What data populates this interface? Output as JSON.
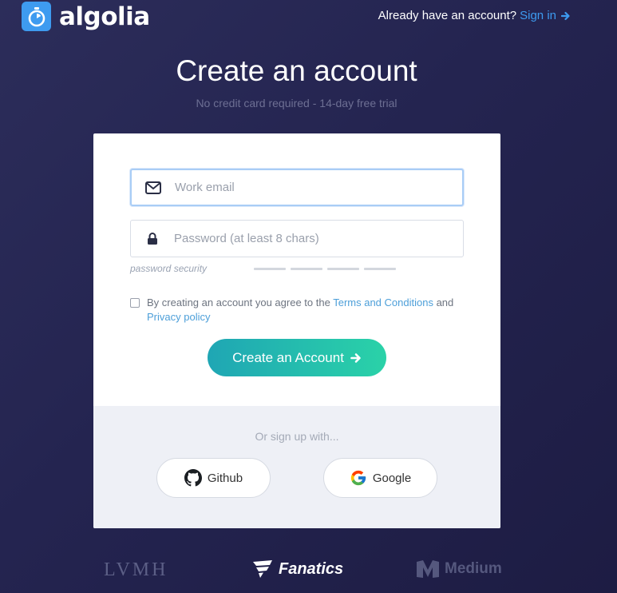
{
  "header": {
    "logo_text": "algolia",
    "signin_prompt": "Already have an account?",
    "signin_link": "Sign in"
  },
  "main": {
    "title": "Create an account",
    "subtitle": "No credit card required - 14-day free trial"
  },
  "form": {
    "email_placeholder": "Work email",
    "email_value": "",
    "password_placeholder": "Password (at least 8 chars)",
    "password_value": "",
    "password_security_label": "password security",
    "password_strength_level": 0,
    "terms_prefix": "By creating an account you agree to the",
    "terms_link": "Terms and Conditions",
    "terms_and": "and",
    "privacy_link": "Privacy policy",
    "terms_checked": false,
    "submit_label": "Create an Account"
  },
  "social": {
    "prompt": "Or sign up with...",
    "github_label": "Github",
    "google_label": "Google"
  },
  "brands": {
    "lvmh": "LVMH",
    "fanatics": "Fanatics",
    "medium": "Medium"
  },
  "colors": {
    "accent_blue": "#3d9bf0",
    "cta_start": "#1fa6b4",
    "cta_end": "#2ad2a8",
    "background": "#242450"
  },
  "icons": {
    "logo": "stopwatch-icon",
    "signin": "arrow-right-icon",
    "email": "envelope-icon",
    "password": "lock-icon",
    "submit": "arrow-right-icon",
    "github": "github-icon",
    "google": "google-icon"
  }
}
